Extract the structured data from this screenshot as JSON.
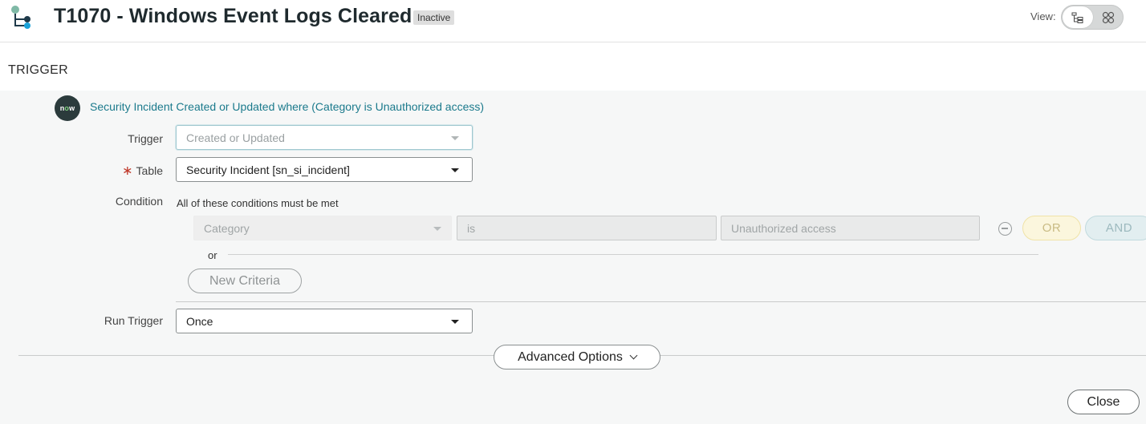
{
  "header": {
    "title": "T1070 - Windows Event Logs Cleared",
    "status": "Inactive",
    "view_label": "View:"
  },
  "section": {
    "title": "TRIGGER"
  },
  "trigger": {
    "icon_text": {
      "n": "n",
      "o": "o",
      "w": "w"
    },
    "summary": "Security Incident Created or Updated where (Category is Unauthorized access)",
    "fields": {
      "trigger_label": "Trigger",
      "trigger_value": "Created or Updated",
      "table_label": "Table",
      "table_value": "Security Incident [sn_si_incident]",
      "condition_label": "Condition",
      "condition_hint": "All of these conditions must be met",
      "run_label": "Run Trigger",
      "run_value": "Once"
    },
    "condition_row": {
      "field": "Category",
      "operator": "is",
      "value": "Unauthorized access",
      "or_button": "OR",
      "and_button": "AND"
    },
    "or_separator": "or",
    "new_criteria": "New Criteria",
    "advanced_options": "Advanced Options"
  },
  "footer": {
    "close": "Close"
  }
}
